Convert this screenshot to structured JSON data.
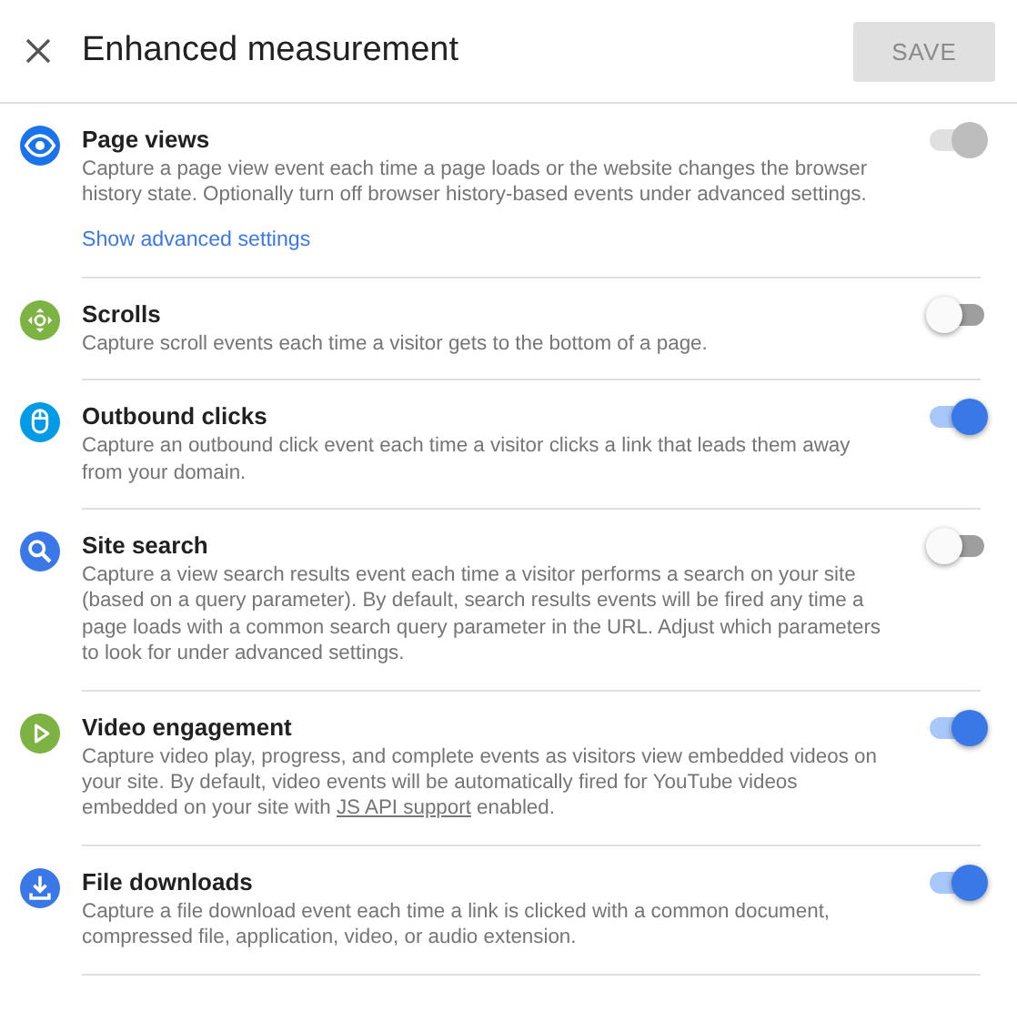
{
  "header": {
    "title": "Enhanced measurement",
    "save_button": {
      "label": "SAVE",
      "disabled": true
    }
  },
  "settings": [
    {
      "kind": "eye",
      "color": "#1a73e8",
      "title": "Page views",
      "description": "Capture a page view event each time a page loads or the website changes the browser history state. Optionally turn off browser history-based events under advanced settings.",
      "on": true,
      "disabled": true,
      "link": "Show advanced settings"
    },
    {
      "kind": "scroll",
      "color": "#7cb342",
      "title": "Scrolls",
      "description": "Capture scroll events each time a visitor gets to the bottom of a page.",
      "on": false,
      "disabled": false
    },
    {
      "kind": "mouse",
      "color": "#039be5",
      "title": "Outbound clicks",
      "description": "Capture an outbound click event each time a visitor clicks a link that leads them away from your domain.",
      "on": true,
      "disabled": false
    },
    {
      "kind": "search",
      "color": "#3b78e7",
      "title": "Site search",
      "description": "Capture a view search results event each time a visitor performs a search on your site (based on a query parameter). By default, search results events will be fired any time a page loads with a common search query parameter in the URL. Adjust which parameters to look for under advanced settings.",
      "on": false,
      "disabled": false
    },
    {
      "kind": "play",
      "color": "#7cb342",
      "title": "Video engagement",
      "description": "Capture video play, progress, and complete events as visitors view embedded videos on your site. By default, video events will be automatically fired for YouTube videos embedded on your site with",
      "inline_link": "JS API support",
      "description_end": "enabled.",
      "on": true,
      "disabled": false
    },
    {
      "kind": "download",
      "color": "#3b78e7",
      "title": "File downloads",
      "description": "Capture a file download event each time a link is clicked with a common document, compressed file, application, video, or audio extension.",
      "on": true,
      "disabled": false
    }
  ]
}
